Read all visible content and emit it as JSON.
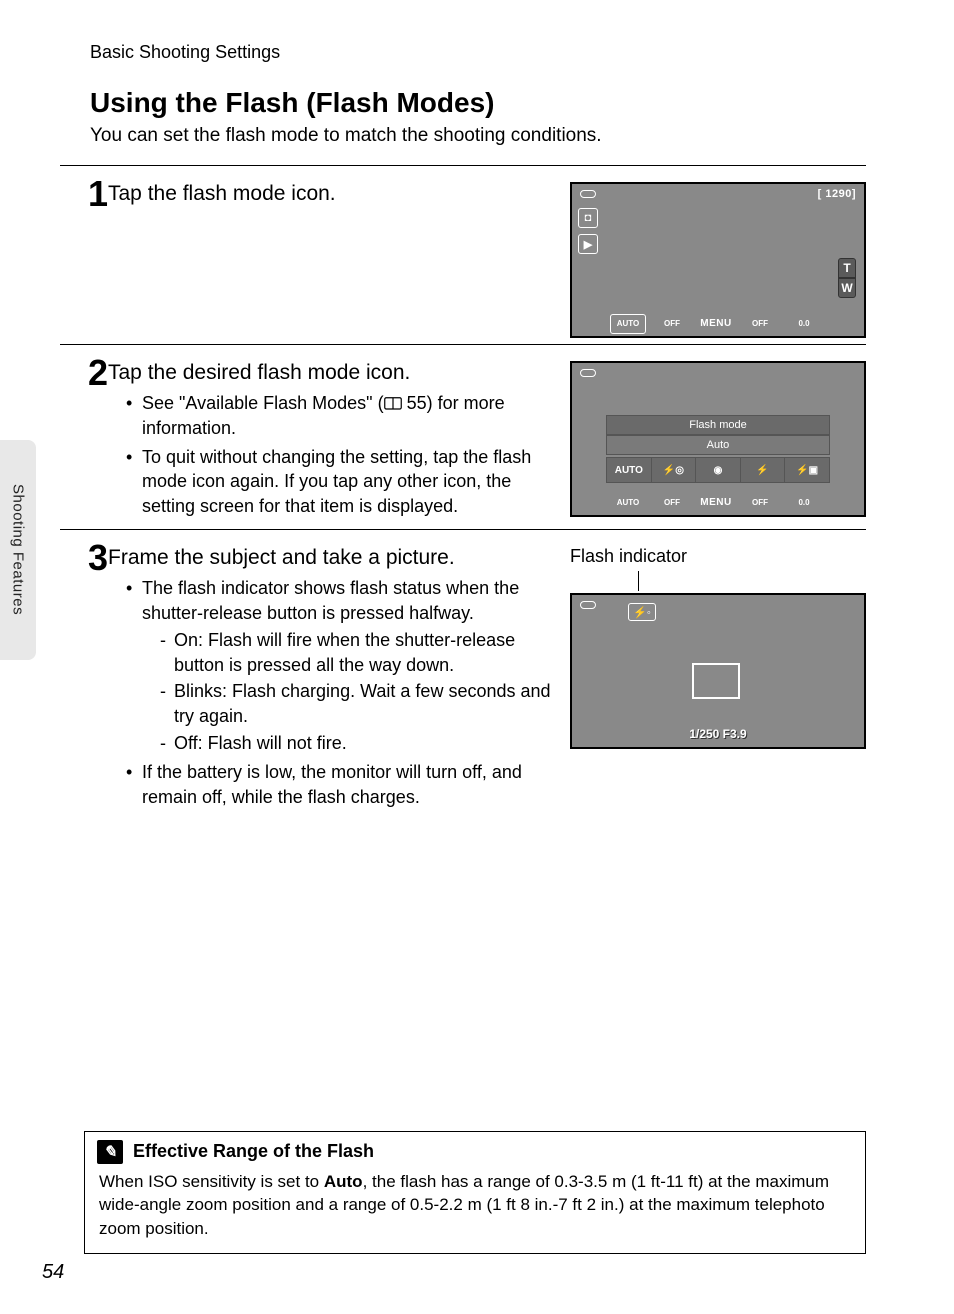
{
  "header": {
    "section": "Basic Shooting Settings"
  },
  "title": "Using the Flash (Flash Modes)",
  "intro": "You can set the flash mode to match the shooting conditions.",
  "side_tab": "Shooting Features",
  "page_number": "54",
  "steps": [
    {
      "num": "1",
      "title": "Tap the flash mode icon.",
      "screen": {
        "count": "[ 1290]",
        "zoom": [
          "T",
          "W"
        ],
        "bottom": [
          "AUTO",
          "OFF",
          "MENU",
          "OFF",
          "0.0"
        ]
      }
    },
    {
      "num": "2",
      "title": "Tap the desired flash mode icon.",
      "bullets": [
        {
          "pre": "See \"Available Flash Modes\" (",
          "ref": "55",
          "post": ") for more information."
        },
        {
          "text": "To quit without changing the setting, tap the flash mode icon again. If you tap any other icon, the setting screen for that item is displayed."
        }
      ],
      "screen": {
        "panel_title": "Flash mode",
        "panel_sub": "Auto",
        "options": [
          "AUTO",
          "⚡◎",
          "◉",
          "⚡",
          "⚡▣"
        ],
        "bottom": [
          "AUTO",
          "OFF",
          "MENU",
          "OFF",
          "0.0"
        ]
      }
    },
    {
      "num": "3",
      "title": "Frame the subject and take a picture.",
      "indicator_label": "Flash indicator",
      "bullets": [
        {
          "text": "The flash indicator shows flash status when the shutter-release button is pressed halfway.",
          "dashes": [
            "On: Flash will fire when the shutter-release button is pressed all the way down.",
            "Blinks: Flash charging. Wait a few seconds and try again.",
            "Off: Flash will not fire."
          ]
        },
        {
          "text": "If the battery is low, the monitor will turn off, and remain off, while the flash charges."
        }
      ],
      "screen": {
        "exif": "1/250 F3.9"
      }
    }
  ],
  "note": {
    "title": "Effective Range of the Flash",
    "body_pre": "When ISO sensitivity is set to ",
    "body_bold": "Auto",
    "body_post": ", the flash has a range of 0.3-3.5 m (1 ft-11 ft) at the maximum wide-angle zoom position and a range of 0.5-2.2 m (1 ft 8 in.-7 ft 2 in.) at the maximum telephoto zoom position."
  }
}
